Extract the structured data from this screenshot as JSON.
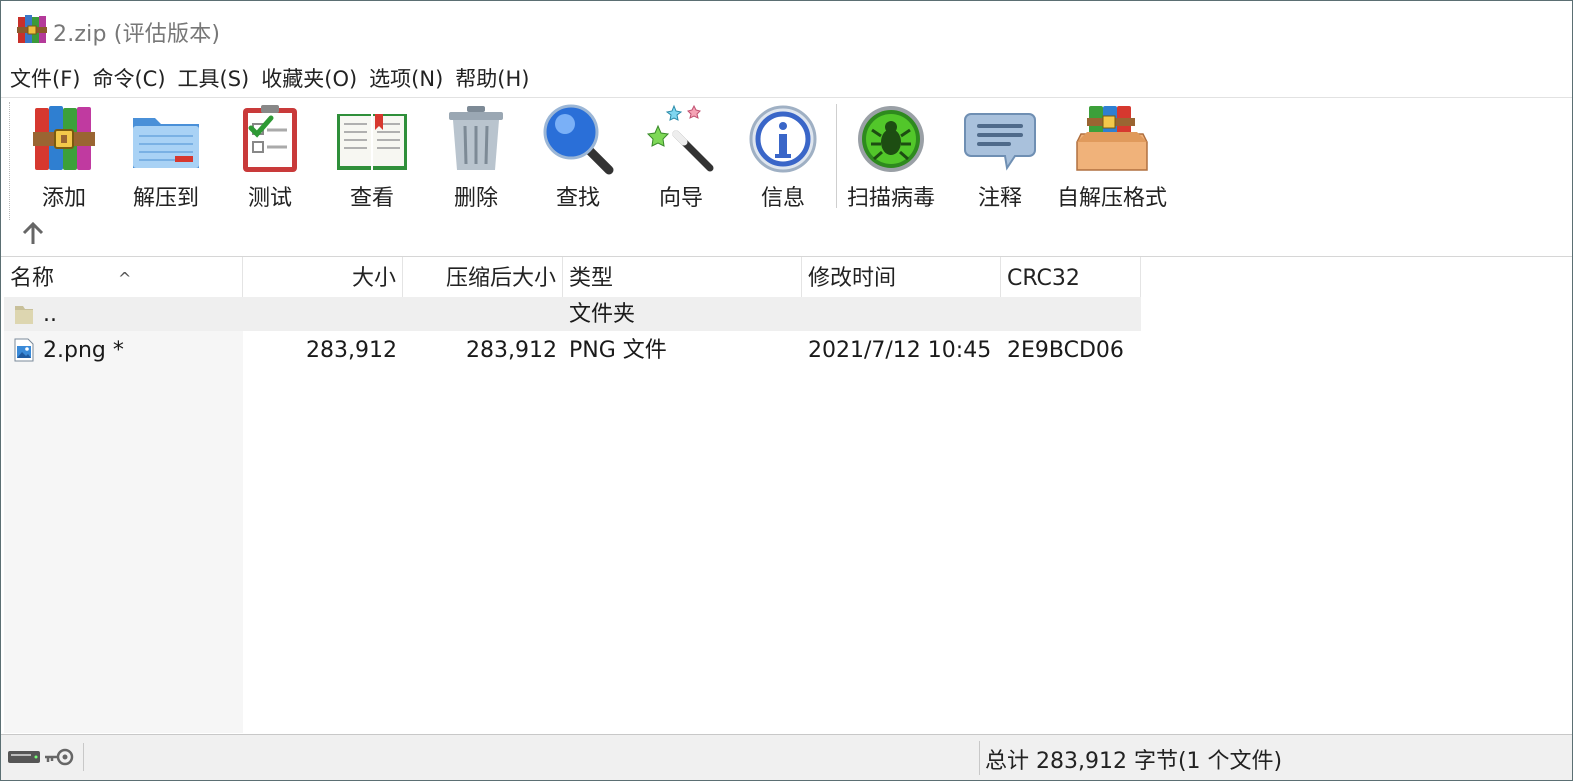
{
  "window": {
    "title": "2.zip (评估版本)"
  },
  "menu": [
    "文件(F)",
    "命令(C)",
    "工具(S)",
    "收藏夹(O)",
    "选项(N)",
    "帮助(H)"
  ],
  "toolbar": {
    "add": "添加",
    "extract": "解压到",
    "test": "测试",
    "view": "查看",
    "delete": "删除",
    "find": "查找",
    "wizard": "向导",
    "info": "信息",
    "virus_scan": "扫描病毒",
    "comment": "注释",
    "sfx": "自解压格式"
  },
  "columns": {
    "name": "名称",
    "size": "大小",
    "packed": "压缩后大小",
    "type": "类型",
    "modified": "修改时间",
    "crc": "CRC32"
  },
  "files": [
    {
      "name": "..",
      "size": "",
      "packed": "",
      "type": "文件夹",
      "modified": "",
      "crc": ""
    },
    {
      "name": "2.png *",
      "size": "283,912",
      "packed": "283,912",
      "type": "PNG 文件",
      "modified": "2021/7/12 10:45",
      "crc": "2E9BCD06"
    }
  ],
  "status": {
    "summary": "总计 283,912 字节(1 个文件)"
  },
  "icons": [
    "winrar-app-icon",
    "archive-books-icon",
    "folder-extract-icon",
    "checklist-icon",
    "open-book-icon",
    "trash-icon",
    "magnifier-icon",
    "magic-wand-icon",
    "info-icon",
    "bug-icon",
    "speech-bubble-icon",
    "box-books-icon",
    "up-arrow-icon",
    "folder-icon",
    "image-file-icon",
    "drive-icon",
    "key-icon"
  ]
}
